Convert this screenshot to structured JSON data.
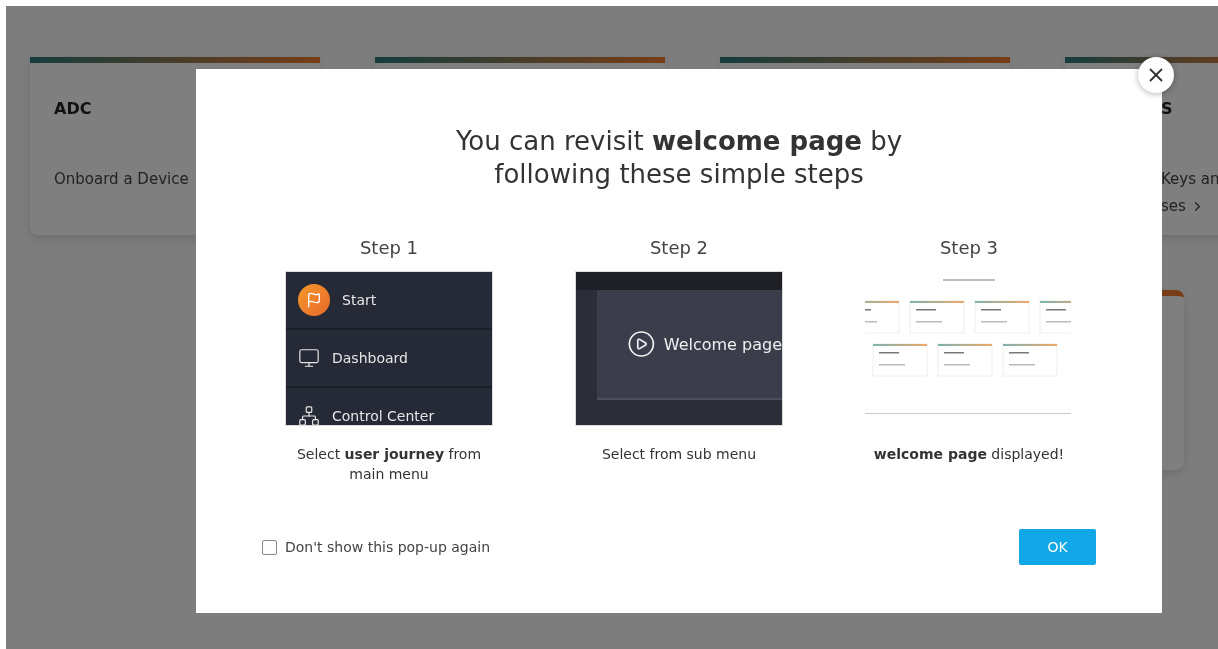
{
  "background": {
    "cards": [
      {
        "kind": "text",
        "title": "ADC",
        "lines": [
          "Onboard a Device"
        ]
      },
      {
        "kind": "blank"
      },
      {
        "kind": "blank"
      }
    ],
    "cut_card": {
      "title": "S",
      "lines": [
        "Keys an",
        "ses"
      ]
    }
  },
  "modal": {
    "title": "You can revisit **welcome page** by\nfollowing these simple steps",
    "steps": [
      {
        "kind": "menu",
        "label": "Step 1",
        "caption": "Select **user journey** from main menu",
        "menu": [
          {
            "label": "Start"
          },
          {
            "label": "Dashboard"
          },
          {
            "label": "Control Center"
          }
        ]
      },
      {
        "kind": "submenu",
        "label": "Step 2",
        "caption": "Select from sub menu",
        "item": "Welcome page"
      },
      {
        "kind": "preview",
        "label": "Step 3",
        "caption": "**welcome page** displayed!"
      }
    ],
    "checkbox": {
      "label": "Don't show this pop-up again",
      "checked": false
    },
    "ok_button": "OK"
  }
}
